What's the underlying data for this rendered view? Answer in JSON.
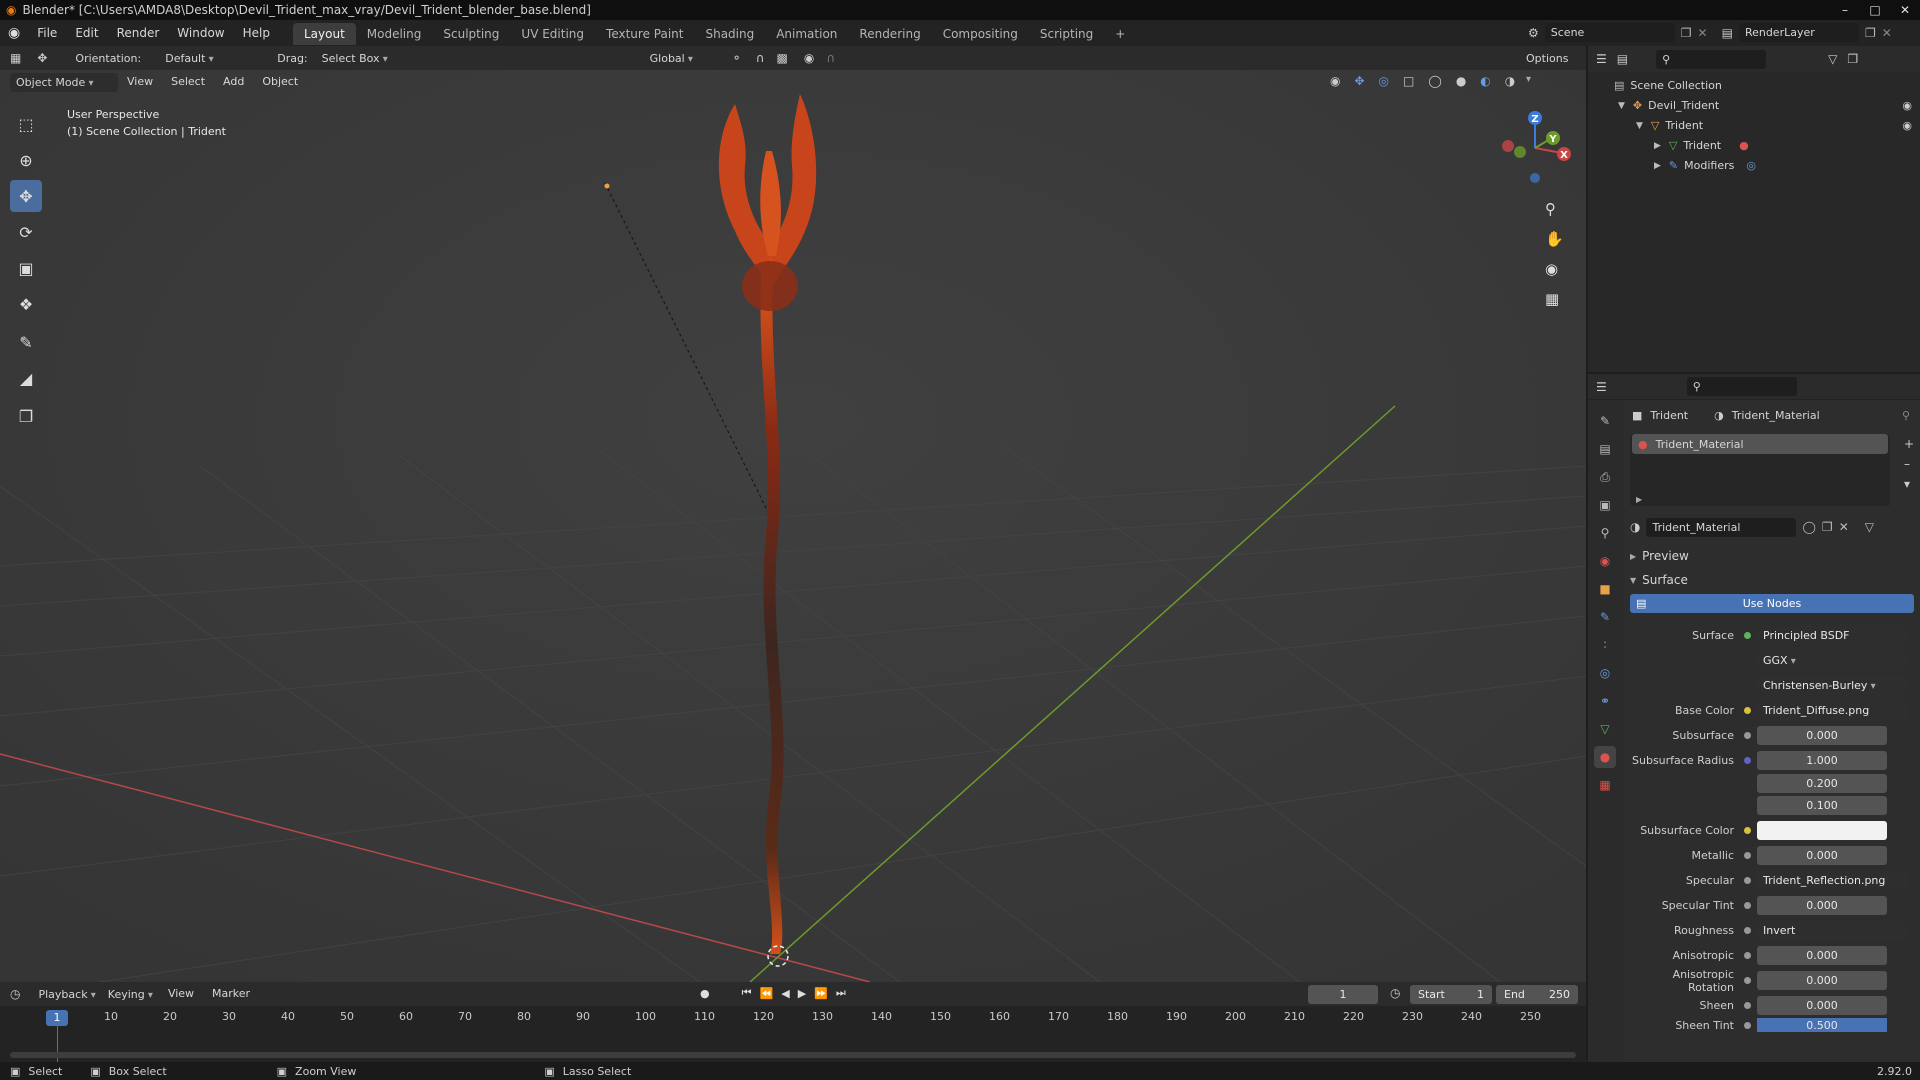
{
  "window": {
    "title": "Blender* [C:\\Users\\AMDA8\\Desktop\\Devil_Trident_max_vray/Devil_Trident_blender_base.blend]",
    "version": "2.92.0"
  },
  "menu": [
    "File",
    "Edit",
    "Render",
    "Window",
    "Help"
  ],
  "workspaces": [
    "Layout",
    "Modeling",
    "Sculpting",
    "UV Editing",
    "Texture Paint",
    "Shading",
    "Animation",
    "Rendering",
    "Compositing",
    "Scripting"
  ],
  "active_workspace": "Layout",
  "scene": {
    "scene_name": "Scene",
    "render_layer": "RenderLayer"
  },
  "viewport_header": {
    "orientation_label": "Orientation:",
    "orientation_value": "Default",
    "drag_label": "Drag:",
    "drag_value": "Select Box",
    "transform": "Global",
    "options": "Options",
    "mode": "Object Mode",
    "menus": [
      "View",
      "Select",
      "Add",
      "Object"
    ]
  },
  "viewport_overlay": {
    "perspective": "User Perspective",
    "collection": "(1) Scene Collection | Trident"
  },
  "gizmo": {
    "z": "Z",
    "y": "Y",
    "x": "X"
  },
  "outliner": {
    "items": [
      {
        "label": "Scene Collection"
      },
      {
        "label": "Devil_Trident"
      },
      {
        "label": "Trident"
      },
      {
        "label": "Trident"
      },
      {
        "label": "Modifiers"
      }
    ]
  },
  "properties": {
    "breadcrumb_object": "Trident",
    "breadcrumb_material": "Trident_Material",
    "slot": "Trident_Material",
    "material_name": "Trident_Material",
    "preview": "Preview",
    "surface_panel": "Surface",
    "use_nodes": "Use Nodes",
    "rows": [
      {
        "label": "Surface",
        "value": "Principled BSDF"
      },
      {
        "label": "",
        "value": "GGX"
      },
      {
        "label": "",
        "value": "Christensen-Burley"
      },
      {
        "label": "Base Color",
        "value": "Trident_Diffuse.png"
      },
      {
        "label": "Subsurface",
        "value": "0.000"
      },
      {
        "label": "Subsurface Radius",
        "value": "1.000"
      },
      {
        "label": "",
        "value": "0.200"
      },
      {
        "label": "",
        "value": "0.100"
      },
      {
        "label": "Subsurface Color",
        "value": ""
      },
      {
        "label": "Metallic",
        "value": "0.000"
      },
      {
        "label": "Specular",
        "value": "Trident_Reflection.png"
      },
      {
        "label": "Specular Tint",
        "value": "0.000"
      },
      {
        "label": "Roughness",
        "value": "Invert"
      },
      {
        "label": "Anisotropic",
        "value": "0.000"
      },
      {
        "label": "Anisotropic Rotation",
        "value": "0.000"
      },
      {
        "label": "Sheen",
        "value": "0.000"
      },
      {
        "label": "Sheen Tint",
        "value": "0.500"
      }
    ]
  },
  "timeline": {
    "menus": [
      "Playback",
      "Keying",
      "View",
      "Marker"
    ],
    "current_frame": "1",
    "start_label": "Start",
    "start_value": "1",
    "end_label": "End",
    "end_value": "250",
    "ticks": [
      "10",
      "20",
      "30",
      "40",
      "50",
      "60",
      "70",
      "80",
      "90",
      "100",
      "110",
      "120",
      "130",
      "140",
      "150",
      "160",
      "170",
      "180",
      "190",
      "200",
      "210",
      "220",
      "230",
      "240",
      "250"
    ]
  },
  "statusbar": {
    "select": "Select",
    "box_select": "Box Select",
    "zoom_view": "Zoom View",
    "lasso_select": "Lasso Select"
  },
  "colors": {
    "accent": "#4b6d9e",
    "use_nodes": "#4772b3",
    "x_axis": "#c74646",
    "y_axis": "#6d9a2b",
    "z_axis": "#3d7cd9"
  }
}
